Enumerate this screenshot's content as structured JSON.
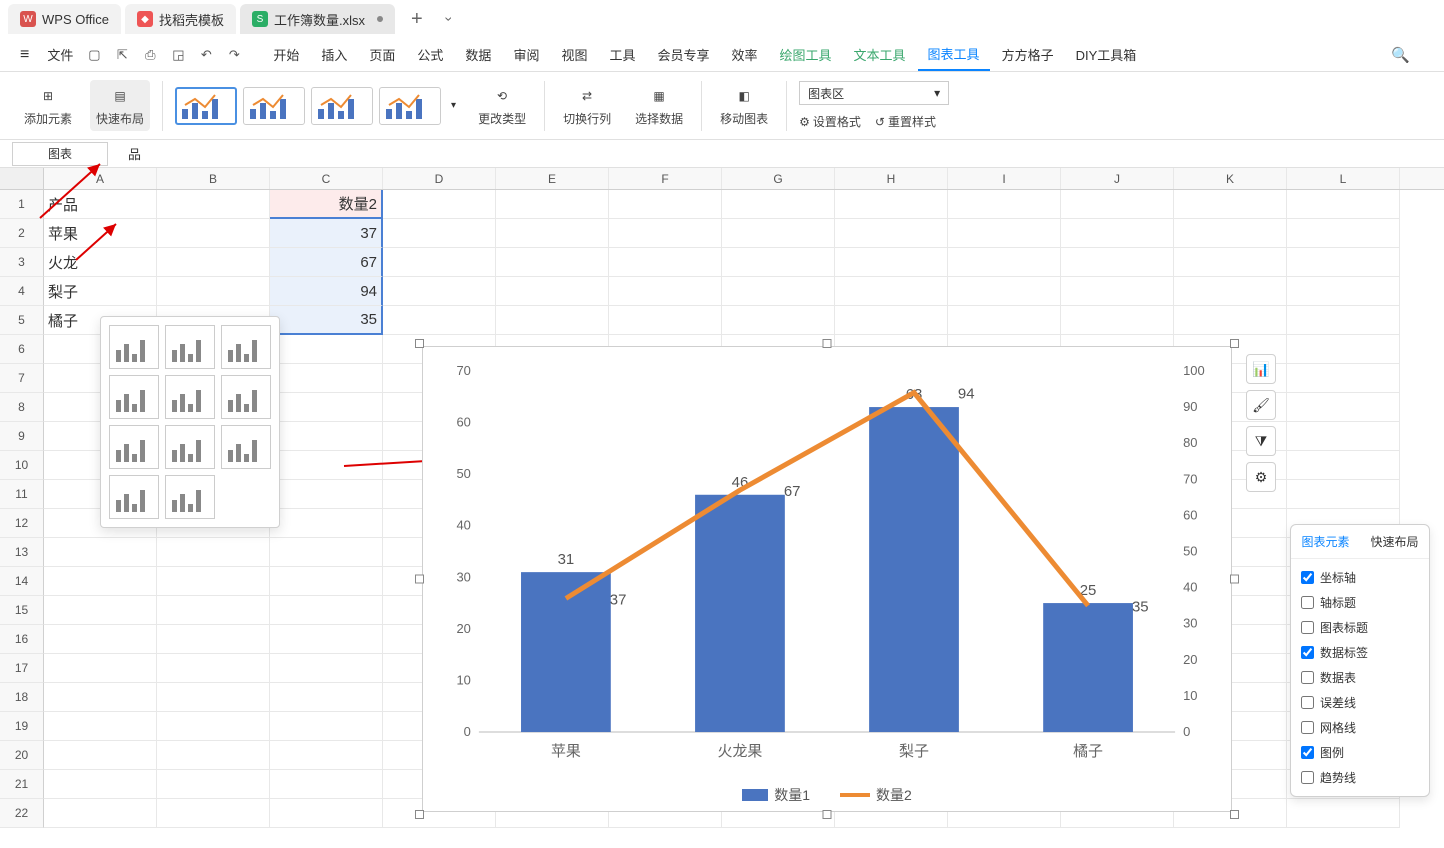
{
  "tabs": {
    "t1": "WPS Office",
    "t2": "找稻壳模板",
    "t3": "工作簿数量.xlsx"
  },
  "menu": {
    "file": "文件",
    "items": [
      "开始",
      "插入",
      "页面",
      "公式",
      "数据",
      "审阅",
      "视图",
      "工具",
      "会员专享",
      "效率",
      "绘图工具",
      "文本工具",
      "图表工具",
      "方方格子",
      "DIY工具箱"
    ]
  },
  "ribbon": {
    "addElement": "添加元素",
    "quickLayout": "快速布局",
    "changeType": "更改类型",
    "switchRowCol": "切换行列",
    "selectData": "选择数据",
    "moveChart": "移动图表",
    "chartArea": "图表区",
    "setFormat": "设置格式",
    "resetStyle": "重置样式"
  },
  "namebox": "图表",
  "fxcell": "品",
  "sheet": {
    "cols": [
      "A",
      "B",
      "C",
      "D",
      "E",
      "F",
      "G",
      "H",
      "I",
      "J",
      "K",
      "L"
    ],
    "rows": [
      "1",
      "2",
      "3",
      "4",
      "5",
      "6",
      "7",
      "8",
      "9",
      "10",
      "11",
      "12",
      "13",
      "14",
      "15",
      "16",
      "17",
      "18",
      "19",
      "20",
      "21",
      "22"
    ],
    "data": {
      "A1": "产品",
      "C1": "数量2",
      "A2": "苹果",
      "C2": "37",
      "A3": "火龙",
      "C3": "67",
      "A4": "梨子",
      "C4": "94",
      "A5": "橘子",
      "C5": "35"
    }
  },
  "elemPanel": {
    "tab1": "图表元素",
    "tab2": "快速布局",
    "items": [
      "坐标轴",
      "轴标题",
      "图表标题",
      "数据标签",
      "数据表",
      "误差线",
      "网格线",
      "图例",
      "趋势线"
    ],
    "checked": [
      true,
      false,
      false,
      true,
      false,
      false,
      false,
      true,
      false
    ]
  },
  "chart_data": {
    "type": "bar",
    "categories": [
      "苹果",
      "火龙果",
      "梨子",
      "橘子"
    ],
    "series": [
      {
        "name": "数量1",
        "type": "bar",
        "values": [
          31,
          46,
          63,
          25
        ],
        "axis": "left",
        "color": "#4a74c0"
      },
      {
        "name": "数量2",
        "type": "line",
        "values": [
          37,
          67,
          94,
          35
        ],
        "axis": "right",
        "color": "#ed8b33"
      }
    ],
    "ylim_left": [
      0,
      70
    ],
    "yticks_left": [
      0,
      10,
      20,
      30,
      40,
      50,
      60,
      70
    ],
    "ylim_right": [
      0,
      100
    ],
    "yticks_right": [
      0,
      10,
      20,
      30,
      40,
      50,
      60,
      70,
      80,
      90,
      100
    ],
    "legend": [
      "数量1",
      "数量2"
    ]
  }
}
